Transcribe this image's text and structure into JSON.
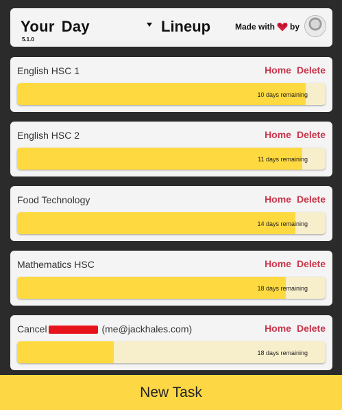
{
  "header": {
    "title_word1": "Your",
    "title_word2": "Day",
    "version": "5.1.0",
    "title_right": "Lineup",
    "made_with": "Made with",
    "by": "by",
    "heart_icon": "heart-icon"
  },
  "tasks": [
    {
      "name": "English HSC 1",
      "home": "Home",
      "delete": "Delete",
      "remaining": "10 days remaining",
      "progress": 0.935
    },
    {
      "name": "English HSC 2",
      "home": "Home",
      "delete": "Delete",
      "remaining": "11 days remaining",
      "progress": 0.924
    },
    {
      "name": "Food Technology",
      "home": "Home",
      "delete": "Delete",
      "remaining": "14 days remaining",
      "progress": 0.902
    },
    {
      "name": "Mathematics HSC",
      "home": "Home",
      "delete": "Delete",
      "remaining": "18 days remaining",
      "progress": 0.871
    },
    {
      "name_prefix": "Cancel",
      "name_suffix": " (me@jackhales.com)",
      "home": "Home",
      "delete": "Delete",
      "remaining": "18 days remaining",
      "progress": 0.313
    }
  ],
  "footer": {
    "new_task": "New Task"
  },
  "colors": {
    "accent": "#fed93f",
    "track": "#f7efcc",
    "action": "#c8354a",
    "background": "#2b2b2b"
  }
}
